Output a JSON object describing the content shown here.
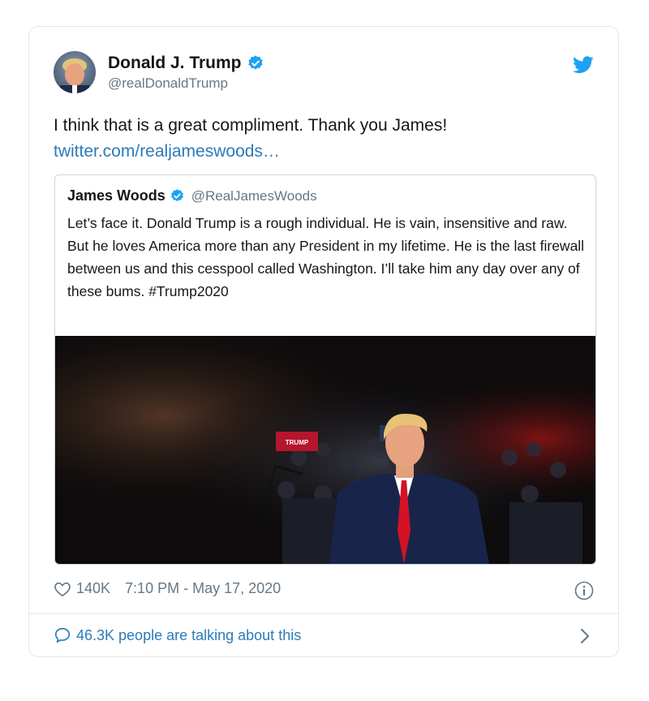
{
  "tweet": {
    "author_name": "Donald J. Trump",
    "handle": "@realDonaldTrump",
    "text": "I think that is a great compliment. Thank you James!",
    "link_text": "twitter.com/realjameswoods…",
    "likes": "140K",
    "time": "7:10 PM - May 17, 2020",
    "talking": "46.3K people are talking about this"
  },
  "quoted": {
    "author_name": "James Woods",
    "handle": "@RealJamesWoods",
    "text": "Let’s face it. Donald Trump is a rough individual. He is vain, insensitive and raw. But he loves America more than any President in my lifetime. He is the last firewall between us and this cesspool called Washington. I’ll take him any day over any of these bums. #Trump2020",
    "photo_sign_text": "TRUMP"
  },
  "icons": {
    "verified": "verified-badge-icon",
    "bird": "twitter-bird-icon",
    "heart": "heart-icon",
    "info": "info-icon",
    "bubble": "speech-bubble-icon",
    "chevron": "chevron-right-icon"
  },
  "colors": {
    "accent": "#1da1f2",
    "link": "#2b7bb9",
    "muted": "#657786",
    "border": "#e1e8ed"
  }
}
